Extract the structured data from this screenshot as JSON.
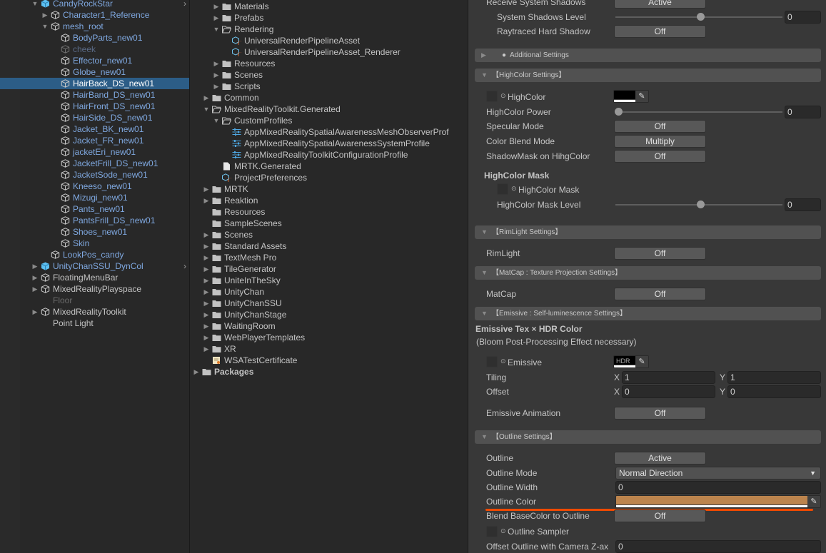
{
  "hierarchy": {
    "nodes": [
      {
        "label": "CandyRockStar",
        "level": 0,
        "arrow": "open",
        "icon": "prefab-icon",
        "style": "blue",
        "chevron": true
      },
      {
        "label": "Character1_Reference",
        "level": 1,
        "arrow": "closed",
        "icon": "gameobject-icon",
        "style": "blue"
      },
      {
        "label": "mesh_root",
        "level": 1,
        "arrow": "open",
        "icon": "gameobject-icon",
        "style": "blue"
      },
      {
        "label": "BodyParts_new01",
        "level": 2,
        "icon": "gameobject-icon",
        "style": "blue"
      },
      {
        "label": "cheek",
        "level": 2,
        "icon": "gameobject-icon",
        "style": "dim"
      },
      {
        "label": "Effector_new01",
        "level": 2,
        "icon": "gameobject-icon",
        "style": "blue"
      },
      {
        "label": "Globe_new01",
        "level": 2,
        "icon": "gameobject-icon",
        "style": "blue"
      },
      {
        "label": "HairBack_DS_new01",
        "level": 2,
        "icon": "gameobject-icon",
        "style": "blue",
        "selected": true
      },
      {
        "label": "HairBand_DS_new01",
        "level": 2,
        "icon": "gameobject-icon",
        "style": "blue"
      },
      {
        "label": "HairFront_DS_new01",
        "level": 2,
        "icon": "gameobject-icon",
        "style": "blue"
      },
      {
        "label": "HairSide_DS_new01",
        "level": 2,
        "icon": "gameobject-icon",
        "style": "blue"
      },
      {
        "label": "Jacket_BK_new01",
        "level": 2,
        "icon": "gameobject-icon",
        "style": "blue"
      },
      {
        "label": "Jacket_FR_new01",
        "level": 2,
        "icon": "gameobject-icon",
        "style": "blue"
      },
      {
        "label": "jacketEri_new01",
        "level": 2,
        "icon": "gameobject-icon",
        "style": "blue"
      },
      {
        "label": "JacketFrill_DS_new01",
        "level": 2,
        "icon": "gameobject-icon",
        "style": "blue"
      },
      {
        "label": "JacketSode_new01",
        "level": 2,
        "icon": "gameobject-icon",
        "style": "blue"
      },
      {
        "label": "Kneeso_new01",
        "level": 2,
        "icon": "gameobject-icon",
        "style": "blue"
      },
      {
        "label": "Mizugi_new01",
        "level": 2,
        "icon": "gameobject-icon",
        "style": "blue"
      },
      {
        "label": "Pants_new01",
        "level": 2,
        "icon": "gameobject-icon",
        "style": "blue"
      },
      {
        "label": "PantsFrill_DS_new01",
        "level": 2,
        "icon": "gameobject-icon",
        "style": "blue"
      },
      {
        "label": "Shoes_new01",
        "level": 2,
        "icon": "gameobject-icon",
        "style": "blue"
      },
      {
        "label": "Skin",
        "level": 2,
        "icon": "gameobject-icon",
        "style": "blue"
      },
      {
        "label": "LookPos_candy",
        "level": 1,
        "icon": "gameobject-icon",
        "style": "blue"
      },
      {
        "label": "UnityChanSSU_DynCol",
        "level": 0,
        "arrow": "closed",
        "icon": "prefab-icon",
        "style": "blue",
        "chevron": true
      },
      {
        "label": "FloatingMenuBar",
        "level": 0,
        "arrow": "closed",
        "icon": "gameobject-icon",
        "style": "normal"
      },
      {
        "label": "MixedRealityPlayspace",
        "level": 0,
        "arrow": "closed",
        "icon": "gameobject-icon",
        "style": "normal"
      },
      {
        "label": "Floor",
        "level": 0,
        "style": "dimw"
      },
      {
        "label": "MixedRealityToolkit",
        "level": 0,
        "arrow": "closed",
        "icon": "gameobject-icon",
        "style": "normal"
      },
      {
        "label": "Point Light",
        "level": 0,
        "style": "normal"
      }
    ]
  },
  "project": {
    "nodes": [
      {
        "label": "Materials",
        "level": 1,
        "arrow": "closed",
        "icon": "folder-icon"
      },
      {
        "label": "Prefabs",
        "level": 1,
        "arrow": "closed",
        "icon": "folder-icon"
      },
      {
        "label": "Rendering",
        "level": 1,
        "arrow": "open",
        "icon": "folder-open-icon"
      },
      {
        "label": "UniversalRenderPipelineAsset",
        "level": 2,
        "icon": "scriptable-asset-icon"
      },
      {
        "label": "UniversalRenderPipelineAsset_Renderer",
        "level": 2,
        "icon": "scriptable-asset-icon"
      },
      {
        "label": "Resources",
        "level": 1,
        "arrow": "closed",
        "icon": "folder-icon"
      },
      {
        "label": "Scenes",
        "level": 1,
        "arrow": "closed",
        "icon": "folder-icon"
      },
      {
        "label": "Scripts",
        "level": 1,
        "arrow": "closed",
        "icon": "folder-icon"
      },
      {
        "label": "Common",
        "level": 0,
        "arrow": "closed",
        "icon": "folder-icon"
      },
      {
        "label": "MixedRealityToolkit.Generated",
        "level": 0,
        "arrow": "open",
        "icon": "folder-open-icon"
      },
      {
        "label": "CustomProfiles",
        "level": 1,
        "arrow": "open",
        "icon": "folder-open-icon"
      },
      {
        "label": "AppMixedRealitySpatialAwarenessMeshObserverProf",
        "level": 2,
        "icon": "profile-icon"
      },
      {
        "label": "AppMixedRealitySpatialAwarenessSystemProfile",
        "level": 2,
        "icon": "profile-icon"
      },
      {
        "label": "AppMixedRealityToolkitConfigurationProfile",
        "level": 2,
        "icon": "profile-icon"
      },
      {
        "label": "MRTK.Generated",
        "level": 1,
        "icon": "file-icon"
      },
      {
        "label": "ProjectPreferences",
        "level": 1,
        "icon": "scriptable-asset-icon"
      },
      {
        "label": "MRTK",
        "level": 0,
        "arrow": "closed",
        "icon": "folder-icon"
      },
      {
        "label": "Reaktion",
        "level": 0,
        "arrow": "closed",
        "icon": "folder-icon"
      },
      {
        "label": "Resources",
        "level": 0,
        "icon": "folder-icon"
      },
      {
        "label": "SampleScenes",
        "level": 0,
        "icon": "folder-icon"
      },
      {
        "label": "Scenes",
        "level": 0,
        "arrow": "closed",
        "icon": "folder-icon"
      },
      {
        "label": "Standard Assets",
        "level": 0,
        "arrow": "closed",
        "icon": "folder-icon"
      },
      {
        "label": "TextMesh Pro",
        "level": 0,
        "arrow": "closed",
        "icon": "folder-icon"
      },
      {
        "label": "TileGenerator",
        "level": 0,
        "arrow": "closed",
        "icon": "folder-icon"
      },
      {
        "label": "UniteInTheSky",
        "level": 0,
        "arrow": "closed",
        "icon": "folder-icon"
      },
      {
        "label": "UnityChan",
        "level": 0,
        "arrow": "closed",
        "icon": "folder-icon"
      },
      {
        "label": "UnityChanSSU",
        "level": 0,
        "arrow": "closed",
        "icon": "folder-icon"
      },
      {
        "label": "UnityChanStage",
        "level": 0,
        "arrow": "closed",
        "icon": "folder-icon"
      },
      {
        "label": "WaitingRoom",
        "level": 0,
        "arrow": "closed",
        "icon": "folder-icon"
      },
      {
        "label": "WebPlayerTemplates",
        "level": 0,
        "arrow": "closed",
        "icon": "folder-icon"
      },
      {
        "label": "XR",
        "level": 0,
        "arrow": "closed",
        "icon": "folder-icon"
      },
      {
        "label": "WSATestCertificate",
        "level": 0,
        "icon": "certificate-icon"
      },
      {
        "label": "Packages",
        "level": -1,
        "arrow": "closed",
        "icon": "folder-icon",
        "bold": true
      }
    ]
  },
  "inspector": {
    "receive_shadows": {
      "label": "Receive System Shadows",
      "value": "Active"
    },
    "shadows_level": {
      "label": "System Shadows Level",
      "value": "0",
      "slider": 0.5
    },
    "raytraced": {
      "label": "Raytraced Hard Shadow",
      "value": "Off"
    },
    "additional": {
      "label": "Additional Settings"
    },
    "highcolor_header": "【HighColor Settings】",
    "highcolor": {
      "label": "HighColor",
      "color": "#000000"
    },
    "highcolor_power": {
      "label": "HighColor Power",
      "value": "0",
      "slider": 0.0
    },
    "specular": {
      "label": "Specular Mode",
      "value": "Off"
    },
    "blend_mode": {
      "label": "Color Blend Mode",
      "value": "Multiply"
    },
    "shadowmask": {
      "label": "ShadowMask on HihgColor",
      "value": "Off"
    },
    "highcolor_mask_title": "HighColor Mask",
    "highcolor_mask": {
      "label": "HighColor Mask"
    },
    "highcolor_mask_level": {
      "label": "HighColor Mask Level",
      "value": "0",
      "slider": 0.5
    },
    "rim_header": "【RimLight Settings】",
    "rimlight": {
      "label": "RimLight",
      "value": "Off"
    },
    "matcap_header": "【MatCap : Texture Projection Settings】",
    "matcap": {
      "label": "MatCap",
      "value": "Off"
    },
    "emissive_header": "【Emissive : Self-luminescence Settings】",
    "emissive_title": "Emissive Tex × HDR Color",
    "emissive_note": "(Bloom Post-Processing Effect necessary)",
    "emissive": {
      "label": "Emissive",
      "hdr": "HDR",
      "color": "#000000"
    },
    "tiling": {
      "label": "Tiling",
      "x_label": "X",
      "x": "1",
      "y_label": "Y",
      "y": "1"
    },
    "offset": {
      "label": "Offset",
      "x_label": "X",
      "x": "0",
      "y_label": "Y",
      "y": "0"
    },
    "emissive_anim": {
      "label": "Emissive Animation",
      "value": "Off"
    },
    "outline_header": "【Outline Settings】",
    "outline": {
      "label": "Outline",
      "value": "Active"
    },
    "outline_mode": {
      "label": "Outline Mode",
      "value": "Normal Direction"
    },
    "outline_width": {
      "label": "Outline Width",
      "value": "0"
    },
    "outline_color": {
      "label": "Outline Color",
      "color": "#bc844d",
      "highlight": "#f04a00"
    },
    "blend_base": {
      "label": "Blend BaseColor to Outline",
      "value": "Off"
    },
    "outline_sampler": {
      "label": "Outline Sampler"
    },
    "offset_camera": {
      "label": "Offset Outline with Camera Z-ax",
      "value": "0"
    }
  }
}
